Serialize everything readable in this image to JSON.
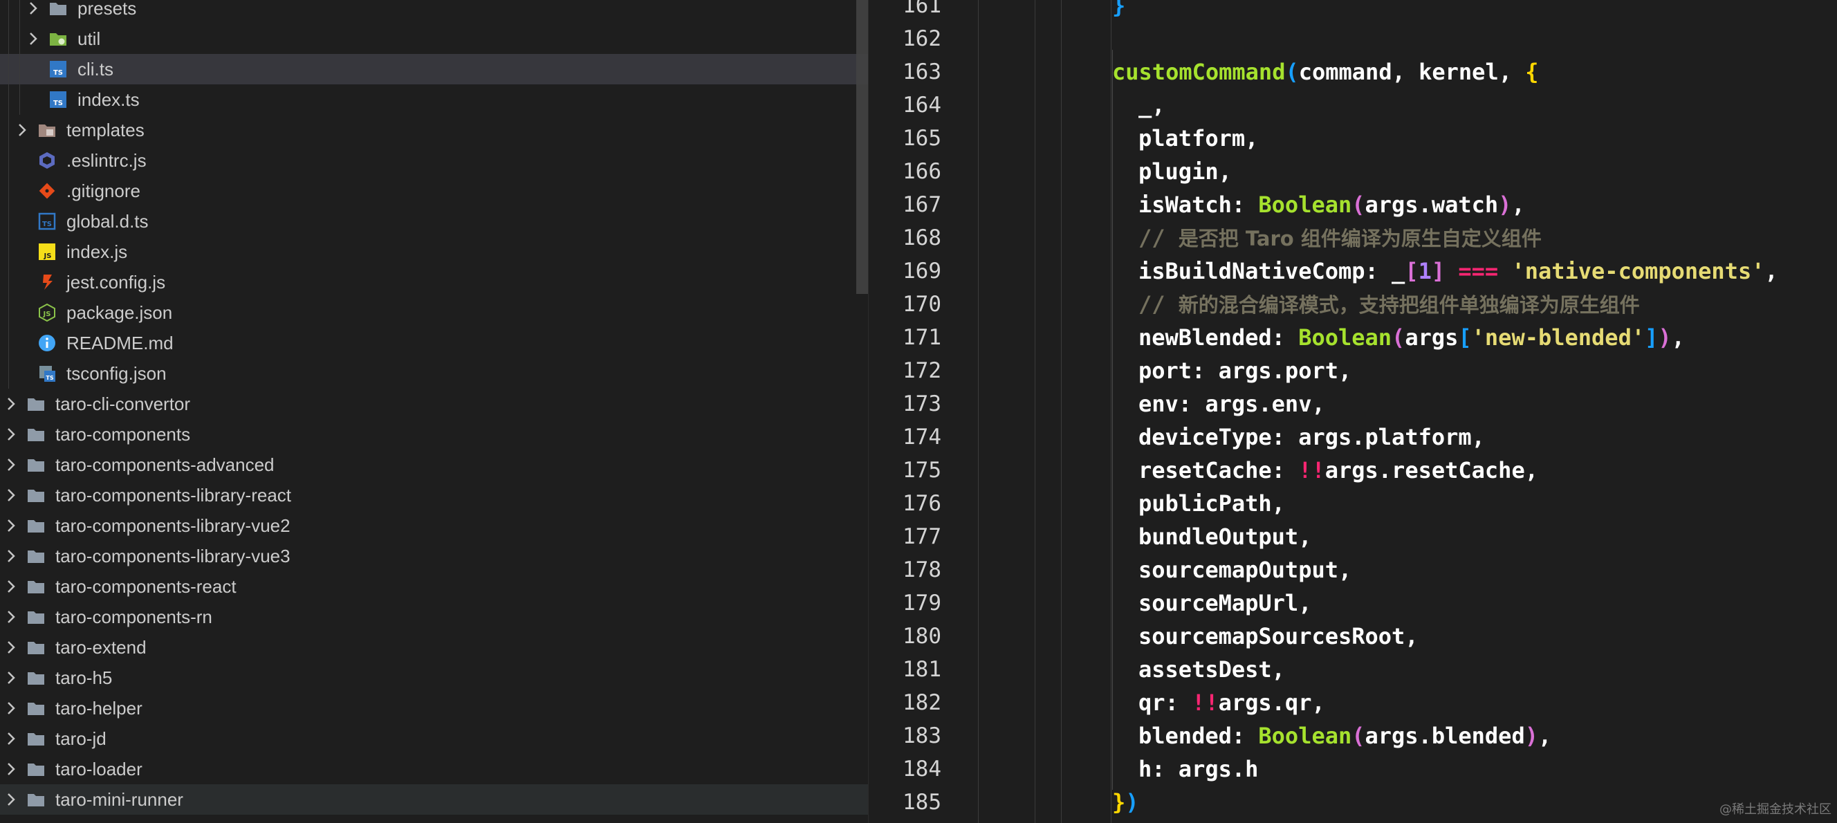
{
  "explorer": {
    "items": [
      {
        "label": "presets",
        "kind": "folder"
      },
      {
        "label": "util",
        "kind": "folder"
      },
      {
        "label": "cli.ts",
        "kind": "ts"
      },
      {
        "label": "index.ts",
        "kind": "ts"
      },
      {
        "label": "templates",
        "kind": "folder"
      },
      {
        "label": ".eslintrc.js",
        "kind": "eslint"
      },
      {
        "label": ".gitignore",
        "kind": "git"
      },
      {
        "label": "global.d.ts",
        "kind": "dts"
      },
      {
        "label": "index.js",
        "kind": "js"
      },
      {
        "label": "jest.config.js",
        "kind": "jest"
      },
      {
        "label": "package.json",
        "kind": "json"
      },
      {
        "label": "README.md",
        "kind": "info"
      },
      {
        "label": "tsconfig.json",
        "kind": "tsconfig"
      },
      {
        "label": "taro-cli-convertor",
        "kind": "folder"
      },
      {
        "label": "taro-components",
        "kind": "folder"
      },
      {
        "label": "taro-components-advanced",
        "kind": "folder"
      },
      {
        "label": "taro-components-library-react",
        "kind": "folder"
      },
      {
        "label": "taro-components-library-vue2",
        "kind": "folder"
      },
      {
        "label": "taro-components-library-vue3",
        "kind": "folder"
      },
      {
        "label": "taro-components-react",
        "kind": "folder"
      },
      {
        "label": "taro-components-rn",
        "kind": "folder"
      },
      {
        "label": "taro-extend",
        "kind": "folder"
      },
      {
        "label": "taro-h5",
        "kind": "folder"
      },
      {
        "label": "taro-helper",
        "kind": "folder"
      },
      {
        "label": "taro-jd",
        "kind": "folder"
      },
      {
        "label": "taro-loader",
        "kind": "folder"
      },
      {
        "label": "taro-mini-runner",
        "kind": "folder"
      }
    ],
    "selected_item": "cli.ts",
    "hovered_item": "taro-mini-runner"
  },
  "editor": {
    "line_numbers": [
      "161",
      "162",
      "163",
      "164",
      "165",
      "166",
      "167",
      "168",
      "169",
      "170",
      "171",
      "172",
      "173",
      "174",
      "175",
      "176",
      "177",
      "178",
      "179",
      "180",
      "181",
      "182",
      "183",
      "184",
      "185"
    ],
    "tokens": {
      "l161": "}",
      "l163_fn": "customCommand",
      "l163_p1": "(",
      "l163_args": "command, kernel, ",
      "l163_brace": "{",
      "l164": "_,",
      "l165": "platform,",
      "l166": "plugin,",
      "l167_key": "isWatch: ",
      "l167_fn": "Boolean",
      "l167_p1": "(",
      "l167_arg": "args.watch",
      "l167_p2": ")",
      "l167_end": ",",
      "l168_slash": "// ",
      "l168_text": "是否把 Taro 组件编译为原生自定义组件",
      "l169_key": "isBuildNativeComp: _",
      "l169_b1": "[",
      "l169_num": "1",
      "l169_b2": "]",
      "l169_op": " === ",
      "l169_str": "'native-components'",
      "l169_end": ",",
      "l170_slash": "// ",
      "l170_text": "新的混合编译模式，支持把组件单独编译为原生组件",
      "l171_key": "newBlended: ",
      "l171_fn": "Boolean",
      "l171_p1": "(",
      "l171_arg": "args",
      "l171_b1": "[",
      "l171_str": "'new-blended'",
      "l171_b2": "]",
      "l171_p2": ")",
      "l171_end": ",",
      "l172": "port: args.port,",
      "l173": "env: args.env,",
      "l174": "deviceType: args.platform,",
      "l175_key": "resetCache: ",
      "l175_op": "!!",
      "l175_rest": "args.resetCache,",
      "l176": "publicPath,",
      "l177": "bundleOutput,",
      "l178": "sourcemapOutput,",
      "l179": "sourceMapUrl,",
      "l180": "sourcemapSourcesRoot,",
      "l181": "assetsDest,",
      "l182_key": "qr: ",
      "l182_op": "!!",
      "l182_rest": "args.qr,",
      "l183_key": "blended: ",
      "l183_fn": "Boolean",
      "l183_p1": "(",
      "l183_arg": "args.blended",
      "l183_p2": ")",
      "l183_end": ",",
      "l184": "h: args.h",
      "l185_brace": "}",
      "l185_paren": ")"
    }
  },
  "watermark": "@稀土掘金技术社区",
  "colors": {
    "background": "#1e1e1e",
    "selection": "#37373d",
    "function": "#a6e22e",
    "string": "#e6db74",
    "number": "#ae81ff",
    "operator": "#f92672",
    "comment": "#75715e",
    "bracket_gold": "#ffd700",
    "bracket_purple": "#da70d6",
    "bracket_blue": "#179fff"
  }
}
